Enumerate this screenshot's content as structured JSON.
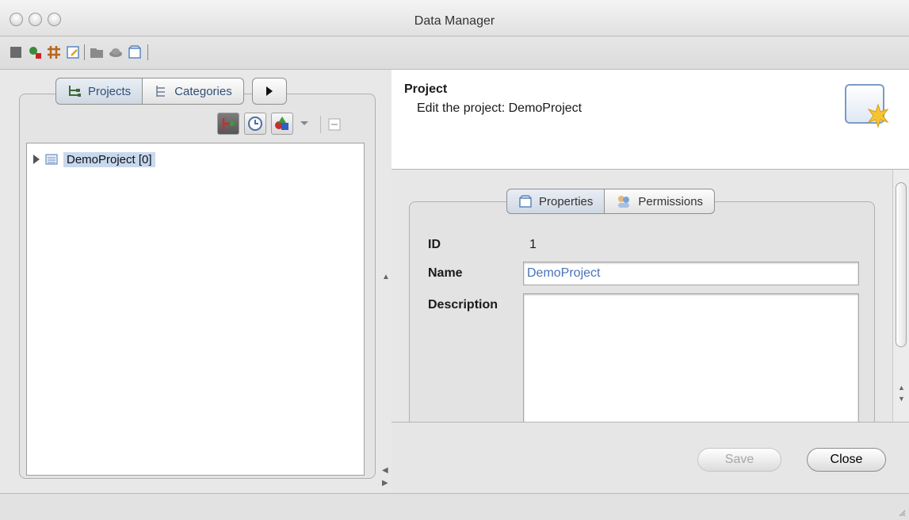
{
  "window": {
    "title": "Data Manager"
  },
  "toolbar": {
    "icons": [
      "stop-icon",
      "search-user-icon",
      "grid-icon",
      "document-edit-icon",
      "folder-icon",
      "hat-icon",
      "box-icon"
    ]
  },
  "left_panel": {
    "tabs": [
      {
        "label": "Projects",
        "icon": "projects-tree-icon"
      },
      {
        "label": "Categories",
        "icon": "categories-tree-icon"
      }
    ],
    "more_icon": "play-arrow-icon",
    "tree": {
      "items": [
        {
          "label": "DemoProject [0]",
          "icon": "project-icon",
          "selected": true
        }
      ]
    }
  },
  "header": {
    "title": "Project",
    "subtitle": "Edit the project: DemoProject",
    "icon": "new-project-icon"
  },
  "form": {
    "tabs": [
      {
        "label": "Properties",
        "icon": "properties-icon"
      },
      {
        "label": "Permissions",
        "icon": "permissions-icon"
      }
    ],
    "id_label": "ID",
    "id_value": "1",
    "name_label": "Name",
    "name_value": "DemoProject",
    "description_label": "Description",
    "description_value": ""
  },
  "footer": {
    "save_label": "Save",
    "close_label": "Close"
  },
  "colors": {
    "selection": "#c8d8ee",
    "input_text": "#4a72b7",
    "accent_blue": "#7b9cc4"
  }
}
